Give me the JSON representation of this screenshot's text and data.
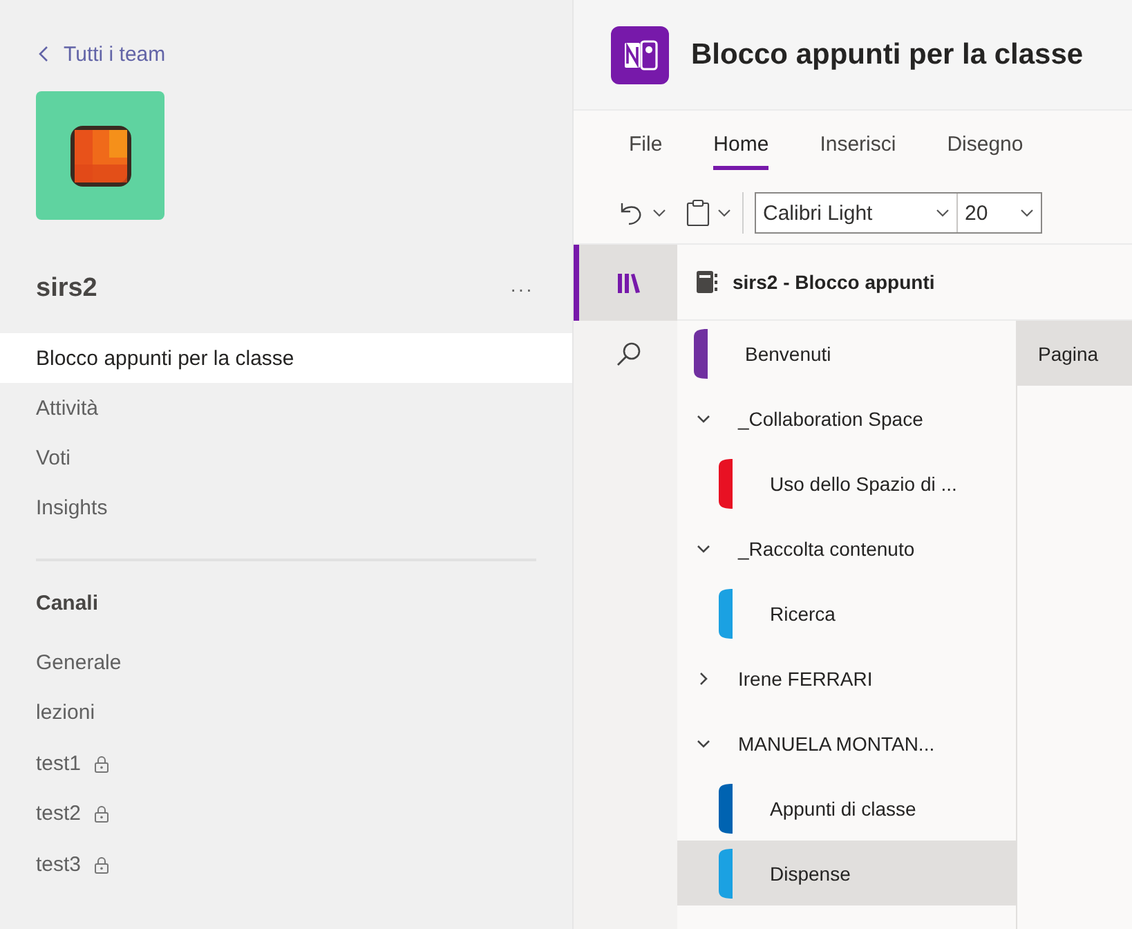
{
  "sidebar": {
    "back_link": "Tutti i team",
    "team_name": "sirs2",
    "more": "···",
    "tabs": [
      {
        "label": "Blocco appunti per la classe",
        "selected": true
      },
      {
        "label": "Attività",
        "selected": false
      },
      {
        "label": "Voti",
        "selected": false
      },
      {
        "label": "Insights",
        "selected": false
      }
    ],
    "channels_heading": "Canali",
    "channels": [
      {
        "name": "Generale",
        "private": false
      },
      {
        "name": "lezioni",
        "private": false
      },
      {
        "name": "test1",
        "private": true
      },
      {
        "name": "test2",
        "private": true
      },
      {
        "name": "test3",
        "private": true
      }
    ]
  },
  "app": {
    "title": "Blocco appunti per la classe",
    "ribbon_tabs": [
      {
        "label": "File",
        "selected": false
      },
      {
        "label": "Home",
        "selected": true
      },
      {
        "label": "Inserisci",
        "selected": false
      },
      {
        "label": "Disegno",
        "selected": false
      }
    ],
    "font_name": "Calibri Light",
    "font_size": "20",
    "rail": [
      {
        "kind": "notebooks",
        "selected": true
      },
      {
        "kind": "search",
        "selected": false
      }
    ],
    "notebook": "sirs2 - Blocco appunti",
    "sections": [
      {
        "kind": "section",
        "name": "Benvenuti",
        "color": "#7030a0",
        "selected": false
      },
      {
        "kind": "group",
        "name": "_Collaboration Space",
        "expanded": true,
        "children": [
          {
            "kind": "section",
            "name": "Uso dello Spazio di ...",
            "color": "#e81123",
            "selected": false
          }
        ]
      },
      {
        "kind": "group",
        "name": "_Raccolta contenuto",
        "expanded": true,
        "children": [
          {
            "kind": "section",
            "name": "Ricerca",
            "color": "#1ba1e2",
            "selected": false
          }
        ]
      },
      {
        "kind": "group",
        "name": "Irene FERRARI",
        "expanded": false
      },
      {
        "kind": "group",
        "name": "MANUELA MONTAN...",
        "expanded": true,
        "children": [
          {
            "kind": "section",
            "name": "Appunti di classe",
            "color": "#0063b1",
            "selected": false
          },
          {
            "kind": "section",
            "name": "Dispense",
            "color": "#1ba1e2",
            "selected": true
          }
        ]
      }
    ],
    "pages": [
      {
        "title": "Pagina",
        "selected": true
      }
    ]
  }
}
